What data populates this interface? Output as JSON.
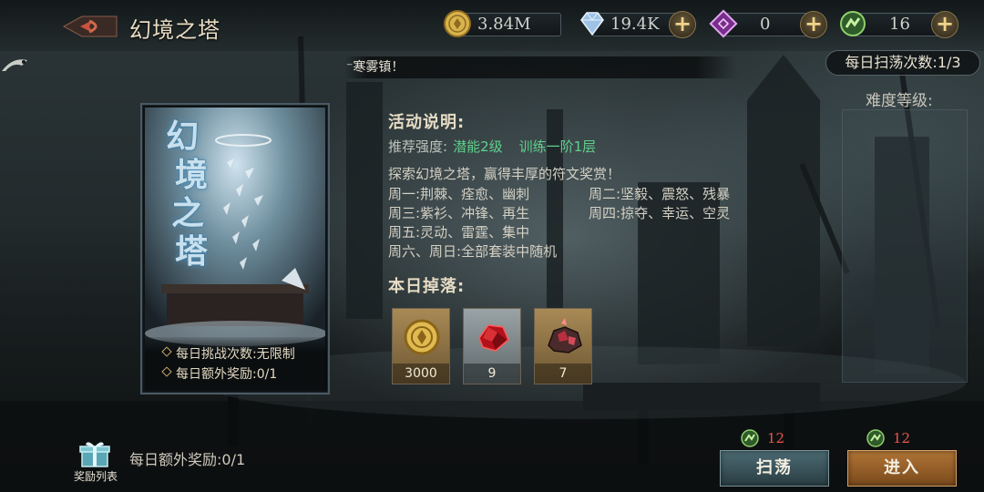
{
  "header": {
    "title": "幻境之塔"
  },
  "resources": [
    {
      "name": "gold",
      "icon": "gold-coin-icon",
      "value": "3.84M",
      "has_plus": false
    },
    {
      "name": "diamond",
      "icon": "diamond-icon",
      "value": "19.4K",
      "has_plus": true
    },
    {
      "name": "rune",
      "icon": "purple-rune-icon",
      "value": "0",
      "has_plus": true
    },
    {
      "name": "stamina",
      "icon": "green-stamina-icon",
      "value": "16",
      "has_plus": true
    }
  ],
  "plus_symbol": "+",
  "ticker": "⁻寒雾镇！",
  "sweep_counter": "每日扫荡次数:1/3",
  "card": {
    "title_chars": [
      "幻",
      "境",
      "之",
      "塔"
    ],
    "daily_challenges": "每日挑战次数:无限制",
    "daily_extra_reward": "每日额外奖励:0/1"
  },
  "activity": {
    "heading": "活动说明:",
    "recommend_label": "推荐强度:",
    "recommend_value_1": "潜能2级",
    "recommend_value_2": "训练一阶1层",
    "intro": "探索幻境之塔，赢得丰厚的符文奖赏！",
    "schedule": [
      {
        "day": "周一:",
        "sets": "荆棘、痊愈、幽刺"
      },
      {
        "day": "周二:",
        "sets": "坚毅、震怒、残暴"
      },
      {
        "day": "周三:",
        "sets": "紫衫、冲锋、再生"
      },
      {
        "day": "周四:",
        "sets": "掠夺、幸运、空灵"
      },
      {
        "day": "周五:",
        "sets": "灵动、雷霆、集中"
      },
      {
        "day": "周六、周日:",
        "sets": "全部套装中随机"
      }
    ]
  },
  "drops": {
    "heading": "本日掉落:",
    "items": [
      {
        "icon": "gold-coin-icon",
        "count": "3000",
        "frame": "gold"
      },
      {
        "icon": "red-gem-icon",
        "count": "9",
        "frame": "grey"
      },
      {
        "icon": "rune-ore-icon",
        "count": "7",
        "frame": "gold"
      }
    ]
  },
  "difficulty": {
    "label": "难度等级:"
  },
  "bottom": {
    "reward_list_label": "奖励列表",
    "daily_extra_reward": "每日额外奖励:0/1",
    "sweep_cost": "12",
    "enter_cost": "12",
    "sweep_label": "扫荡",
    "enter_label": "进入"
  },
  "colors": {
    "recommend_green": "#5fd18c",
    "cost_red": "#e9564a",
    "enter_orange": "#b07436",
    "sweep_teal": "#4b6a72"
  }
}
